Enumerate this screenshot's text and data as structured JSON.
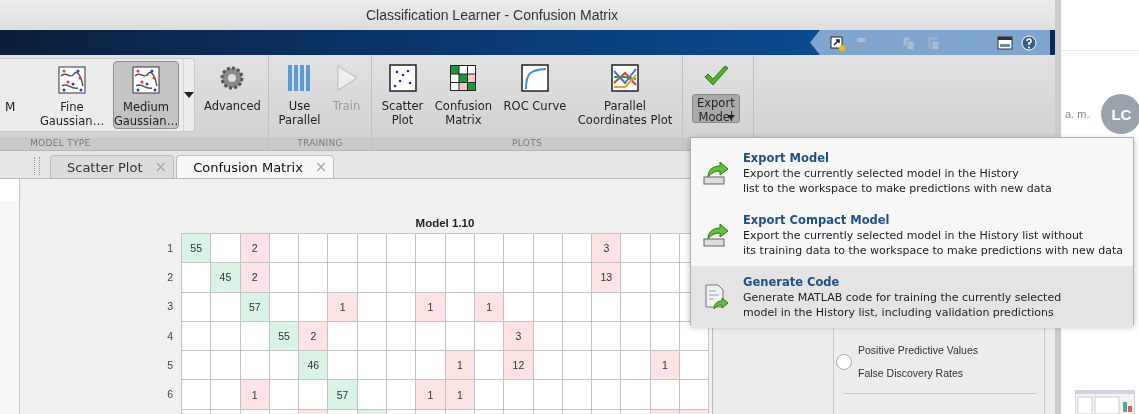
{
  "window": {
    "title": "Classification Learner - Confusion Matrix"
  },
  "quick_access": [
    {
      "kind": "shortcut",
      "disabled": false
    },
    {
      "kind": "save",
      "disabled": true
    },
    {
      "kind": "cut",
      "disabled": true
    },
    {
      "kind": "copy",
      "disabled": true
    },
    {
      "kind": "paste",
      "disabled": true
    },
    {
      "kind": "undo",
      "disabled": true
    },
    {
      "kind": "redo",
      "disabled": true
    },
    {
      "kind": "layout",
      "disabled": false
    },
    {
      "kind": "help",
      "disabled": false
    }
  ],
  "ribbon": {
    "groups": [
      {
        "label": "MODEL TYPE",
        "gallery": [
          {
            "kind": "cut",
            "label": "M",
            "pressed": false
          },
          {
            "kind": "gallery",
            "label": "Fine\nGaussian…",
            "pressed": false
          },
          {
            "kind": "gallery",
            "label": "Medium\nGaussian…",
            "pressed": true
          }
        ],
        "items": [
          {
            "kind": "settings",
            "label": "Advanced",
            "pressed": false,
            "disabled": false
          }
        ]
      },
      {
        "label": "TRAINING",
        "items": [
          {
            "kind": "parallel",
            "label": "Use\nParallel",
            "pressed": false,
            "disabled": false
          },
          {
            "kind": "train",
            "label": "Train",
            "pressed": false,
            "disabled": true
          }
        ]
      },
      {
        "label": "PLOTS",
        "items": [
          {
            "kind": "scatter",
            "label": "Scatter\nPlot",
            "pressed": false,
            "disabled": false
          },
          {
            "kind": "confusion",
            "label": "Confusion\nMatrix",
            "pressed": false,
            "disabled": false
          },
          {
            "kind": "roc",
            "label": "ROC Curve",
            "pressed": false,
            "disabled": false
          },
          {
            "kind": "parcoords",
            "label": "Parallel\nCoordinates Plot",
            "pressed": false,
            "disabled": false
          }
        ]
      },
      {
        "items": [
          {
            "kind": "export",
            "label": "Export\nModel",
            "pressed": true,
            "disabled": false
          }
        ]
      }
    ]
  },
  "tabs": [
    {
      "label": "Scatter Plot",
      "close": "×",
      "selected": false
    },
    {
      "label": "Confusion Matrix",
      "close": "×",
      "selected": true
    }
  ],
  "plot": {
    "title": "Model 1.10",
    "rows": [
      {
        "label": "1",
        "cells": [
          {
            "kind": "correct",
            "value": "55"
          },
          {
            "kind": "empty"
          },
          {
            "kind": "error",
            "value": "2"
          },
          {
            "kind": "empty"
          },
          {
            "kind": "empty"
          },
          {
            "kind": "empty"
          },
          {
            "kind": "empty"
          },
          {
            "kind": "empty"
          },
          {
            "kind": "empty"
          },
          {
            "kind": "empty"
          },
          {
            "kind": "empty"
          },
          {
            "kind": "empty"
          },
          {
            "kind": "empty"
          },
          {
            "kind": "empty"
          },
          {
            "kind": "error",
            "value": "3"
          },
          {
            "kind": "empty"
          },
          {
            "kind": "empty"
          },
          {
            "kind": "empty"
          }
        ]
      },
      {
        "label": "2",
        "cells": [
          {
            "kind": "empty"
          },
          {
            "kind": "correct",
            "value": "45"
          },
          {
            "kind": "error",
            "value": "2"
          },
          {
            "kind": "empty"
          },
          {
            "kind": "empty"
          },
          {
            "kind": "empty"
          },
          {
            "kind": "empty"
          },
          {
            "kind": "empty"
          },
          {
            "kind": "empty"
          },
          {
            "kind": "empty"
          },
          {
            "kind": "empty"
          },
          {
            "kind": "empty"
          },
          {
            "kind": "empty"
          },
          {
            "kind": "empty"
          },
          {
            "kind": "error",
            "value": "13"
          },
          {
            "kind": "empty"
          },
          {
            "kind": "empty"
          },
          {
            "kind": "empty"
          }
        ]
      },
      {
        "label": "3",
        "cells": [
          {
            "kind": "empty"
          },
          {
            "kind": "empty"
          },
          {
            "kind": "correct",
            "value": "57"
          },
          {
            "kind": "empty"
          },
          {
            "kind": "empty"
          },
          {
            "kind": "error",
            "value": "1"
          },
          {
            "kind": "empty"
          },
          {
            "kind": "empty"
          },
          {
            "kind": "error",
            "value": "1"
          },
          {
            "kind": "empty"
          },
          {
            "kind": "error",
            "value": "1"
          },
          {
            "kind": "empty"
          },
          {
            "kind": "empty"
          },
          {
            "kind": "empty"
          },
          {
            "kind": "empty"
          },
          {
            "kind": "empty"
          },
          {
            "kind": "empty"
          },
          {
            "kind": "empty"
          }
        ]
      },
      {
        "label": "4",
        "cells": [
          {
            "kind": "empty"
          },
          {
            "kind": "empty"
          },
          {
            "kind": "empty"
          },
          {
            "kind": "correct",
            "value": "55"
          },
          {
            "kind": "error",
            "value": "2"
          },
          {
            "kind": "empty"
          },
          {
            "kind": "empty"
          },
          {
            "kind": "empty"
          },
          {
            "kind": "empty"
          },
          {
            "kind": "empty"
          },
          {
            "kind": "empty"
          },
          {
            "kind": "error",
            "value": "3"
          },
          {
            "kind": "empty"
          },
          {
            "kind": "empty"
          },
          {
            "kind": "empty"
          },
          {
            "kind": "empty"
          },
          {
            "kind": "empty"
          },
          {
            "kind": "empty"
          }
        ]
      },
      {
        "label": "5",
        "cells": [
          {
            "kind": "empty"
          },
          {
            "kind": "empty"
          },
          {
            "kind": "empty"
          },
          {
            "kind": "empty"
          },
          {
            "kind": "correct",
            "value": "46"
          },
          {
            "kind": "empty"
          },
          {
            "kind": "empty"
          },
          {
            "kind": "empty"
          },
          {
            "kind": "empty"
          },
          {
            "kind": "error",
            "value": "1"
          },
          {
            "kind": "empty"
          },
          {
            "kind": "error",
            "value": "12"
          },
          {
            "kind": "empty"
          },
          {
            "kind": "empty"
          },
          {
            "kind": "empty"
          },
          {
            "kind": "empty"
          },
          {
            "kind": "error",
            "value": "1"
          },
          {
            "kind": "empty"
          }
        ]
      },
      {
        "label": "6",
        "cells": [
          {
            "kind": "empty"
          },
          {
            "kind": "empty"
          },
          {
            "kind": "error",
            "value": "1"
          },
          {
            "kind": "empty"
          },
          {
            "kind": "empty"
          },
          {
            "kind": "correct",
            "value": "57"
          },
          {
            "kind": "empty"
          },
          {
            "kind": "empty"
          },
          {
            "kind": "error",
            "value": "1"
          },
          {
            "kind": "error",
            "value": "1"
          },
          {
            "kind": "empty"
          },
          {
            "kind": "empty"
          },
          {
            "kind": "empty"
          },
          {
            "kind": "empty"
          },
          {
            "kind": "empty"
          },
          {
            "kind": "empty"
          },
          {
            "kind": "empty"
          },
          {
            "kind": "empty"
          }
        ]
      },
      {
        "cells": [
          {
            "kind": "empty"
          },
          {
            "kind": "empty"
          },
          {
            "kind": "empty"
          },
          {
            "kind": "empty"
          },
          {
            "kind": "error"
          },
          {
            "kind": "empty"
          },
          {
            "kind": "correct"
          },
          {
            "kind": "empty"
          },
          {
            "kind": "empty"
          },
          {
            "kind": "empty"
          },
          {
            "kind": "empty"
          },
          {
            "kind": "empty"
          },
          {
            "kind": "empty"
          },
          {
            "kind": "empty"
          },
          {
            "kind": "empty"
          },
          {
            "kind": "empty"
          },
          {
            "kind": "error"
          },
          {
            "kind": "error"
          }
        ]
      }
    ]
  },
  "side_panel": {
    "radio": {
      "selected": false,
      "lines": [
        "Positive Predictive Values",
        "False Discovery Rates"
      ]
    }
  },
  "export_menu": {
    "items": [
      {
        "kind": "export",
        "title": "Export Model",
        "description": "Export the currently selected model in the History\nlist to the workspace to make predictions with new data",
        "highlighted": false
      },
      {
        "kind": "export",
        "title": "Export Compact Model",
        "description": "Export the currently selected model in the History list without\nits training data to the workspace to make predictions with new data",
        "highlighted": false
      },
      {
        "kind": "code",
        "title": "Generate Code",
        "description": "Generate MATLAB code for training the currently selected\nmodel in the History list, including validation predictions",
        "highlighted": true
      }
    ]
  },
  "background_app": {
    "time": "a. m.",
    "avatar": "LC"
  }
}
